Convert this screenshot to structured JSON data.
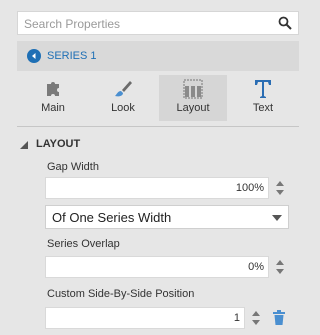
{
  "search": {
    "placeholder": "Search Properties",
    "icon": "search-icon"
  },
  "series": {
    "label": "SERIES 1",
    "icon": "back-arrow-icon",
    "accent": "#1e6fb5"
  },
  "tabs": [
    {
      "label": "Main",
      "icon": "puzzle-icon",
      "active": false
    },
    {
      "label": "Look",
      "icon": "paintbrush-icon",
      "active": false
    },
    {
      "label": "Layout",
      "icon": "layout-grid-icon",
      "active": true
    },
    {
      "label": "Text",
      "icon": "text-t-icon",
      "active": false
    }
  ],
  "section": {
    "title": "LAYOUT"
  },
  "gap_width": {
    "label": "Gap Width",
    "value": "100%"
  },
  "gap_unit": {
    "selected": "Of One Series Width"
  },
  "series_overlap": {
    "label": "Series Overlap",
    "value": "0%"
  },
  "side_by_side": {
    "label": "Custom Side-By-Side Position",
    "value": "1"
  }
}
